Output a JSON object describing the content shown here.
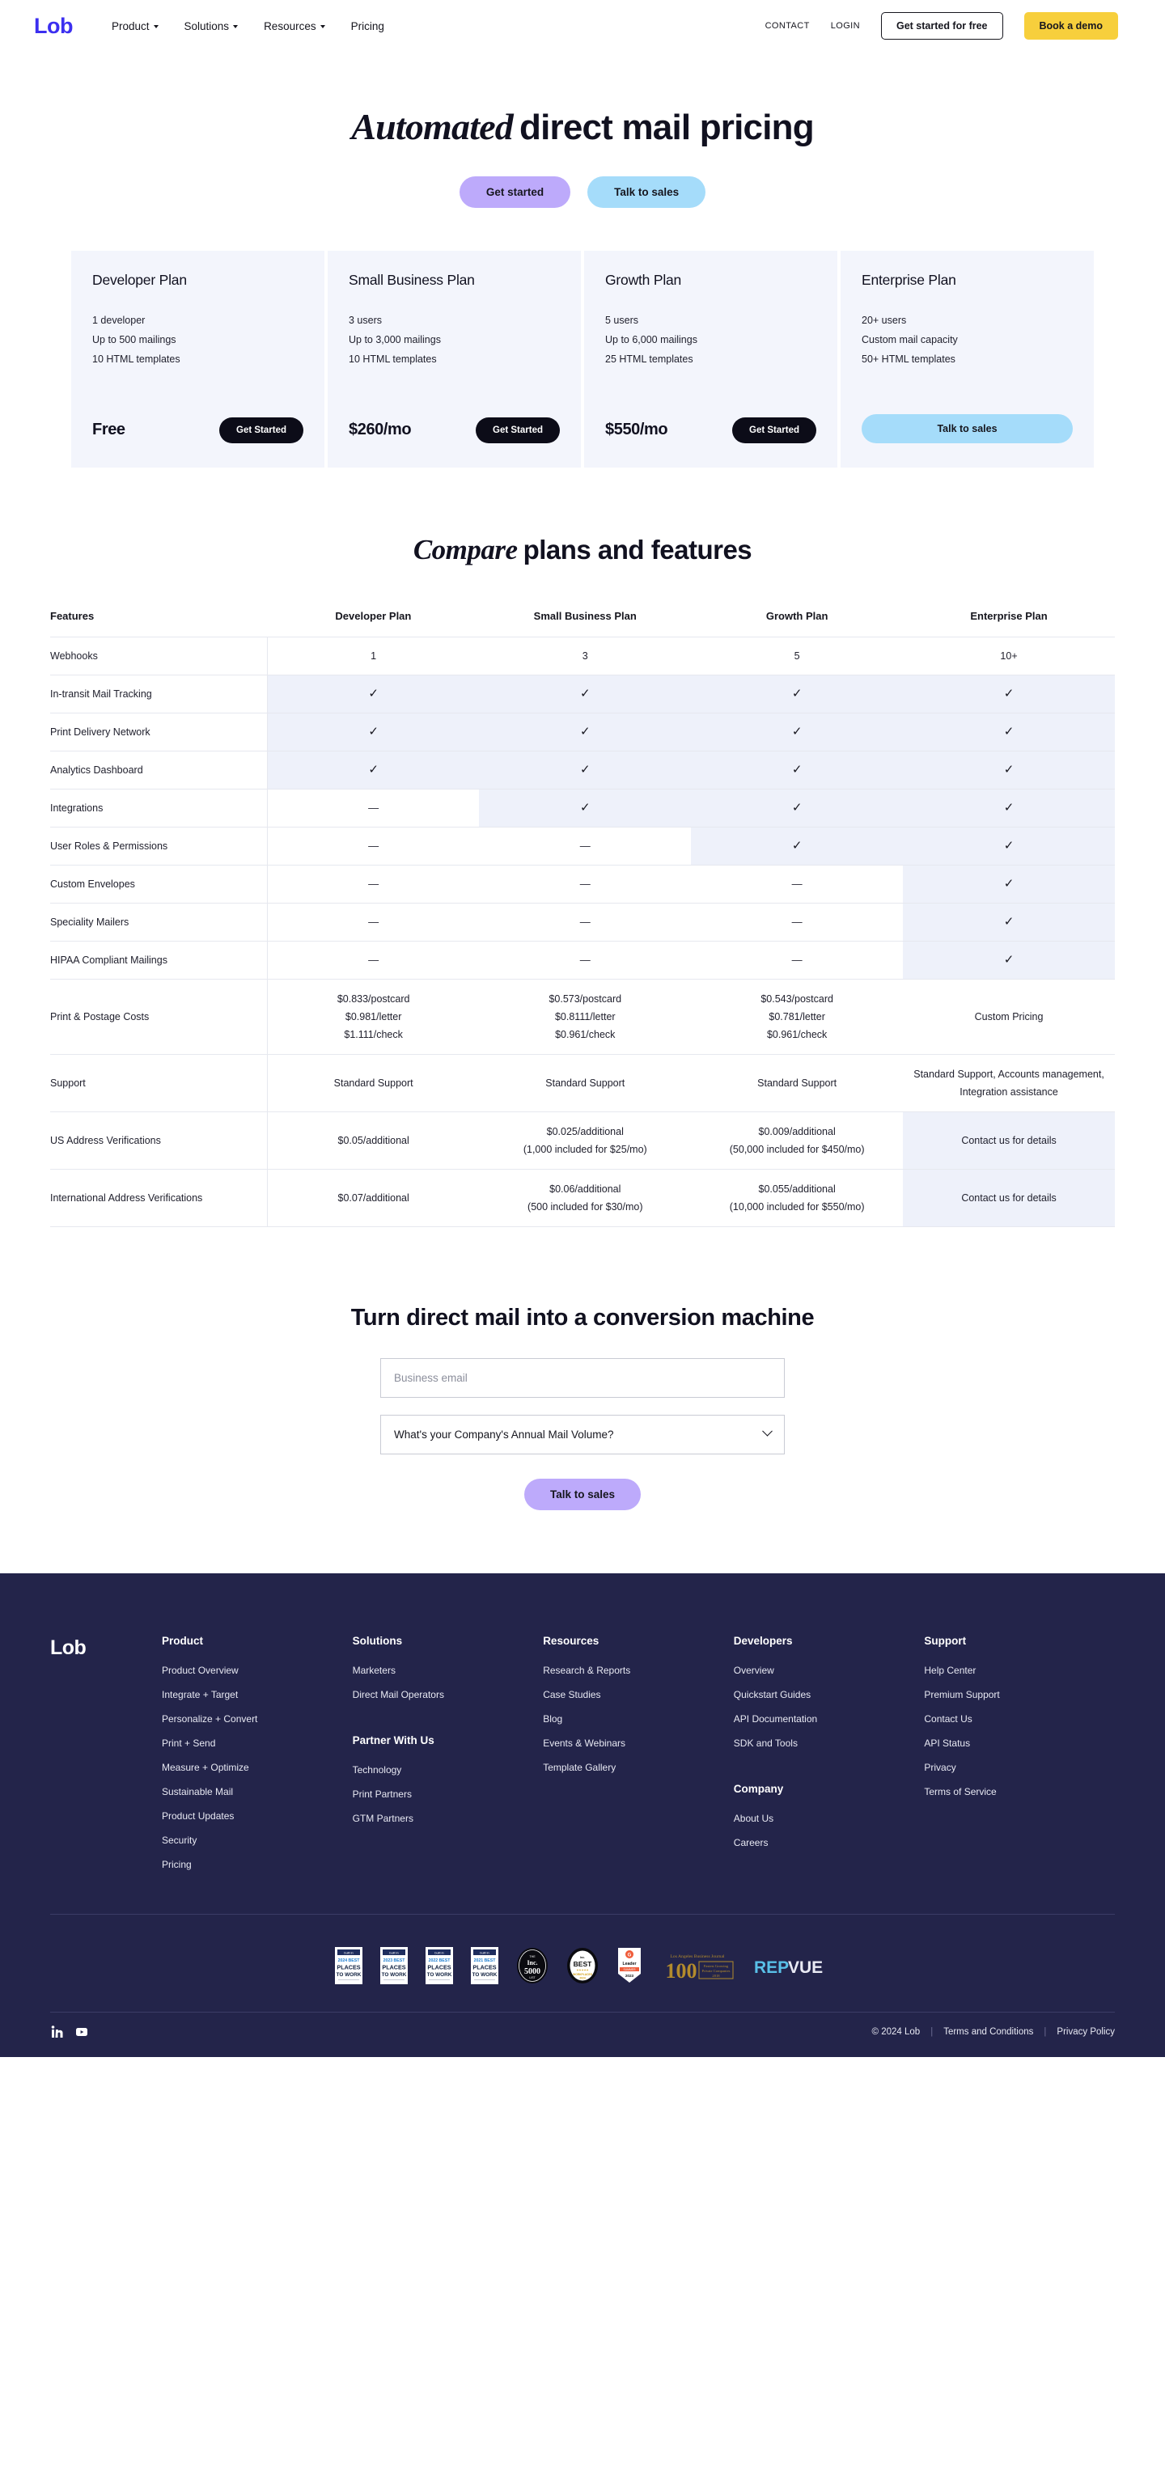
{
  "brand": {
    "name": "Lob",
    "accent": "#3c2ff0",
    "yellow": "#f7cf3c",
    "purple": "#bdaafb",
    "blue": "#a5dcfa",
    "footer_bg": "#23244a"
  },
  "nav": {
    "logo": "Lob",
    "links": [
      {
        "label": "Product",
        "has_caret": true
      },
      {
        "label": "Solutions",
        "has_caret": true
      },
      {
        "label": "Resources",
        "has_caret": true
      },
      {
        "label": "Pricing",
        "has_caret": false
      }
    ],
    "contact": "CONTACT",
    "login": "LOGIN",
    "get_started_free": "Get started for free",
    "book_demo": "Book a demo"
  },
  "hero": {
    "title_italic": "Automated",
    "title_rest": "direct mail pricing",
    "primary_cta": "Get started",
    "secondary_cta": "Talk to sales"
  },
  "plans": [
    {
      "name": "Developer Plan",
      "features": [
        "1 developer",
        "Up to 500 mailings",
        "10 HTML templates"
      ],
      "price": "Free",
      "cta": "Get Started",
      "cta_style": "dark"
    },
    {
      "name": "Small Business Plan",
      "features": [
        "3 users",
        "Up to 3,000 mailings",
        "10 HTML templates"
      ],
      "price": "$260/mo",
      "cta": "Get Started",
      "cta_style": "dark"
    },
    {
      "name": "Growth Plan",
      "features": [
        "5 users",
        "Up to 6,000 mailings",
        "25 HTML templates"
      ],
      "price": "$550/mo",
      "cta": "Get Started",
      "cta_style": "dark"
    },
    {
      "name": "Enterprise Plan",
      "features": [
        "20+ users",
        "Custom mail capacity",
        "50+ HTML templates"
      ],
      "price": "",
      "cta": "Talk to sales",
      "cta_style": "wide-blue"
    }
  ],
  "compare": {
    "title_italic": "Compare",
    "title_rest": "plans and features",
    "columns": [
      "Features",
      "Developer Plan",
      "Small Business Plan",
      "Growth Plan",
      "Enterprise Plan"
    ],
    "rows": [
      {
        "feature": "Webhooks",
        "cells": [
          "1",
          "3",
          "5",
          "10+"
        ],
        "highlight_from": -1
      },
      {
        "feature": "In-transit Mail Tracking",
        "cells": [
          "✓",
          "✓",
          "✓",
          "✓"
        ],
        "highlight_from": 0
      },
      {
        "feature": "Print Delivery Network",
        "cells": [
          "✓",
          "✓",
          "✓",
          "✓"
        ],
        "highlight_from": 0
      },
      {
        "feature": "Analytics Dashboard",
        "cells": [
          "✓",
          "✓",
          "✓",
          "✓"
        ],
        "highlight_from": 0
      },
      {
        "feature": "Integrations",
        "cells": [
          "—",
          "✓",
          "✓",
          "✓"
        ],
        "highlight_from": 1
      },
      {
        "feature": "User Roles & Permissions",
        "cells": [
          "—",
          "—",
          "✓",
          "✓"
        ],
        "highlight_from": 2
      },
      {
        "feature": "Custom Envelopes",
        "cells": [
          "—",
          "—",
          "—",
          "✓"
        ],
        "highlight_from": 3
      },
      {
        "feature": "Speciality Mailers",
        "cells": [
          "—",
          "—",
          "—",
          "✓"
        ],
        "highlight_from": 3
      },
      {
        "feature": "HIPAA Compliant Mailings",
        "cells": [
          "—",
          "—",
          "—",
          "✓"
        ],
        "highlight_from": 3
      }
    ],
    "detail_rows": [
      {
        "feature": "Print & Postage Costs",
        "cells": [
          [
            "$0.833/postcard",
            "$0.981/letter",
            "$1.111/check"
          ],
          [
            "$0.573/postcard",
            "$0.8111/letter",
            "$0.961/check"
          ],
          [
            "$0.543/postcard",
            "$0.781/letter",
            "$0.961/check"
          ],
          [
            "Custom Pricing"
          ]
        ],
        "highlight_from": -1
      },
      {
        "feature": "Support",
        "cells": [
          [
            "Standard Support"
          ],
          [
            "Standard Support"
          ],
          [
            "Standard Support"
          ],
          [
            "Standard Support, Accounts management, Integration assistance"
          ]
        ],
        "highlight_from": -1
      },
      {
        "feature": "US Address Verifications",
        "cells": [
          [
            "$0.05/additional"
          ],
          [
            "$0.025/additional",
            "(1,000 included for $25/mo)"
          ],
          [
            "$0.009/additional",
            "(50,000 included for $450/mo)"
          ],
          [
            "Contact us for details"
          ]
        ],
        "highlight_from": 3
      },
      {
        "feature": "International Address Verifications",
        "cells": [
          [
            "$0.07/additional"
          ],
          [
            "$0.06/additional",
            "(500 included for $30/mo)"
          ],
          [
            "$0.055/additional",
            "(10,000 included for $550/mo)"
          ],
          [
            "Contact us for details"
          ]
        ],
        "highlight_from": 3
      }
    ]
  },
  "cta": {
    "title": "Turn direct mail into a conversion machine",
    "email_placeholder": "Business email",
    "email_value": "",
    "select_value": "What's your Company's Annual Mail Volume?",
    "submit": "Talk to sales"
  },
  "footer": {
    "logo": "Lob",
    "columns": [
      {
        "groups": [
          {
            "heading": "Product",
            "links": [
              "Product Overview",
              "Integrate + Target",
              "Personalize + Convert",
              "Print + Send",
              "Measure + Optimize",
              "Sustainable Mail",
              "Product Updates",
              "Security",
              "Pricing"
            ]
          }
        ]
      },
      {
        "groups": [
          {
            "heading": "Solutions",
            "links": [
              "Marketers",
              "Direct Mail Operators"
            ]
          },
          {
            "heading": "Partner With Us",
            "links": [
              "Technology",
              "Print Partners",
              "GTM Partners"
            ]
          }
        ]
      },
      {
        "groups": [
          {
            "heading": "Resources",
            "links": [
              "Research & Reports",
              "Case Studies",
              "Blog",
              "Events & Webinars",
              "Template Gallery"
            ]
          }
        ]
      },
      {
        "groups": [
          {
            "heading": "Developers",
            "links": [
              "Overview",
              "Quickstart Guides",
              "API Documentation",
              "SDK and Tools"
            ]
          },
          {
            "heading": "Company",
            "links": [
              "About Us",
              "Careers"
            ]
          }
        ]
      },
      {
        "groups": [
          {
            "heading": "Support",
            "links": [
              "Help Center",
              "Premium Support",
              "Contact Us",
              "API Status",
              "Privacy",
              "Terms of Service"
            ]
          }
        ]
      }
    ],
    "badges": [
      {
        "name": "built-in-2024-best-places-to-work",
        "line1": "2024 BEST",
        "line2": "PLACES",
        "line3": "TO WORK",
        "kind": "box"
      },
      {
        "name": "built-in-2023-best-places-to-work",
        "line1": "2023 BEST",
        "line2": "PLACES",
        "line3": "TO WORK",
        "kind": "box"
      },
      {
        "name": "built-in-2022-best-places-to-work-bay-area",
        "line1": "2022 BEST",
        "line2": "PLACES",
        "line3": "TO WORK",
        "kind": "box"
      },
      {
        "name": "built-in-2021-best-places-to-work-bay-area",
        "line1": "2021 BEST",
        "line2": "PLACES",
        "line3": "TO WORK",
        "kind": "box"
      },
      {
        "name": "inc-5000-badge",
        "line1": "Inc.",
        "line2": "5000",
        "kind": "oval-dark"
      },
      {
        "name": "best-workplaces-badge",
        "line1": "BEST",
        "line2": "WORKPLACES",
        "kind": "oval-light"
      },
      {
        "name": "g2-leader-2023-badge",
        "line1": "Leader",
        "line2": "2023",
        "kind": "shield"
      },
      {
        "name": "la-business-journal-100-badge",
        "line1": "100",
        "line2": "Fastest Growing Private Companies",
        "kind": "wide-gold"
      },
      {
        "name": "repvue-badge",
        "line1": "REPVUE",
        "kind": "wordmark"
      }
    ],
    "socials": [
      {
        "name": "linkedin-icon",
        "glyph": "in"
      },
      {
        "name": "youtube-icon",
        "glyph": "▶"
      }
    ],
    "copyright": "© 2024 Lob",
    "terms": "Terms and Conditions",
    "privacy": "Privacy Policy"
  }
}
